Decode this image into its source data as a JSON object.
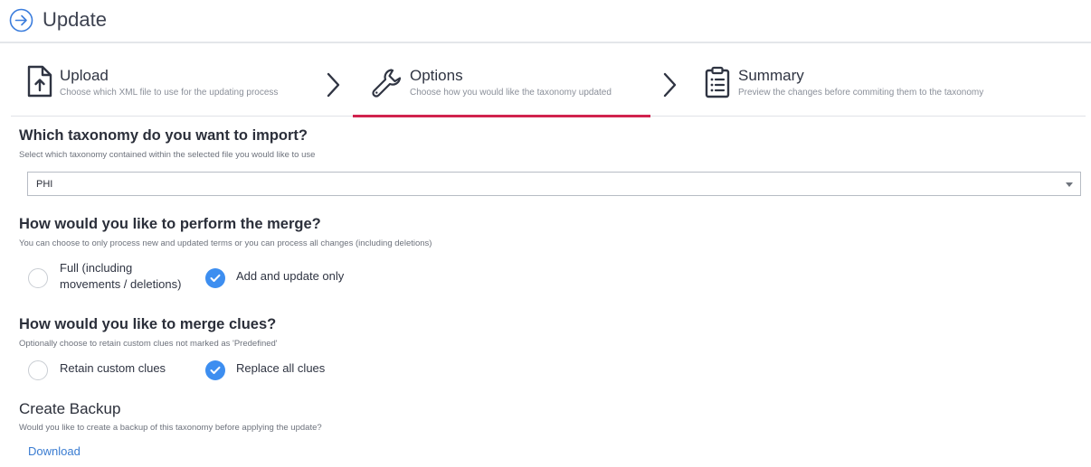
{
  "header": {
    "title": "Update",
    "icon": "arrow-right-circle-icon",
    "accent_color": "#3b7ddd"
  },
  "stepper": {
    "steps": [
      {
        "title": "Upload",
        "description": "Choose which XML file to use for the updating process",
        "icon": "file-upload-icon",
        "active": false
      },
      {
        "title": "Options",
        "description": "Choose how you would like the taxonomy updated",
        "icon": "wrench-icon",
        "active": true
      },
      {
        "title": "Summary",
        "description": "Preview the changes before commiting them to the taxonomy",
        "icon": "clipboard-list-icon",
        "active": false
      }
    ],
    "active_color": "#d1234e"
  },
  "taxonomy": {
    "title": "Which taxonomy do you want to import?",
    "subtitle": "Select which taxonomy contained within the selected file you would like to use",
    "selected": "PHI"
  },
  "merge": {
    "title": "How would you like to perform the merge?",
    "subtitle": "You can choose to only process new and updated terms or you can process all changes (including deletions)",
    "options": [
      {
        "label_line1": "Full (including",
        "label_line2": "movements / deletions)",
        "checked": false
      },
      {
        "label": "Add and update only",
        "checked": true
      }
    ]
  },
  "clues": {
    "title": "How would you like to merge clues?",
    "subtitle": "Optionally choose to retain custom clues not marked as 'Predefined'",
    "options": [
      {
        "label": "Retain custom clues",
        "checked": false
      },
      {
        "label": "Replace all clues",
        "checked": true
      }
    ]
  },
  "backup": {
    "title": "Create Backup",
    "subtitle": "Would you like to create a backup of this taxonomy before applying the update?",
    "link_label": "Download"
  },
  "colors": {
    "radio_checked": "#3d8ef0",
    "link": "#3a7cd1"
  }
}
